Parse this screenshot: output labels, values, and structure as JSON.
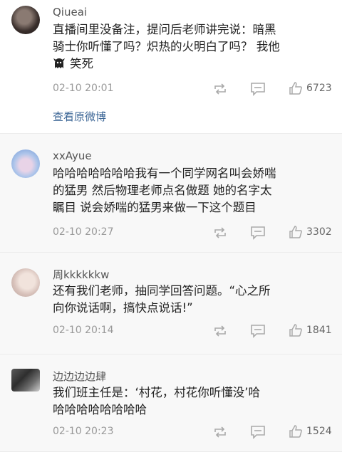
{
  "comments": [
    {
      "username": "Qiueai",
      "text_line1": "直播间里没备注，提问后老师讲完说：暗黑",
      "text_line2": "骑士你听懂了吗？炽热的火明白了吗？ 我他",
      "text_line3": "笑死",
      "emoji_icon": "ghost-icon",
      "timestamp": "02-10 20:01",
      "likes": "6723",
      "view_original": "查看原微博"
    },
    {
      "username": "xxAyue",
      "text_line1": "哈哈哈哈哈哈哈我有一个同学网名叫会娇喘",
      "text_line2": "的猛男 然后物理老师点名做题 她的名字太",
      "text_line3": "瞩目 说会娇喘的猛男来做一下这个题目",
      "timestamp": "02-10 20:27",
      "likes": "3302"
    },
    {
      "username": "周kkkkkkw",
      "text_line1": "还有我们老师，抽同学回答问题。“心之所",
      "text_line2": "向你说话啊，搞快点说话!”",
      "timestamp": "02-10 20:14",
      "likes": "1841"
    },
    {
      "username": "边边边边肆",
      "text_line1": "我们班主任是：‘村花，村花你听懂没’哈",
      "text_line2": "哈哈哈哈哈哈哈哈",
      "timestamp": "02-10 20:23",
      "likes": "1524"
    }
  ],
  "icons": {
    "repost": "repost-icon",
    "comment": "comment-icon",
    "like": "like-icon"
  }
}
